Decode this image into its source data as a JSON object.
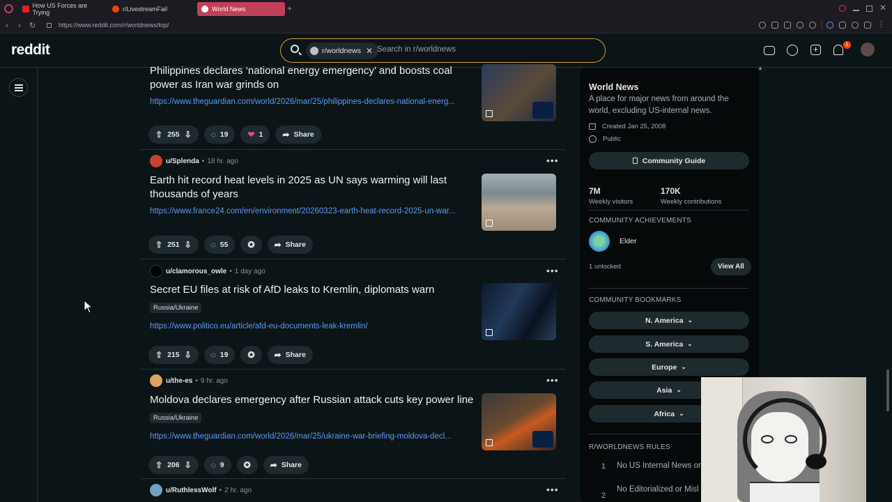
{
  "browser": {
    "tabs": [
      {
        "label": "How US Forces are Trying"
      },
      {
        "label": "r/LivestreamFail"
      },
      {
        "label": "World News"
      }
    ],
    "new_tab": "+",
    "url": "https://www.reddit.com/r/worldnews/top/"
  },
  "header": {
    "logo": "reddit",
    "search_chip": "r/worldnews",
    "search_placeholder": "Search in r/worldnews",
    "notification_count": "1"
  },
  "posts": [
    {
      "title": "Philippines declares ‘national energy emergency’ and boosts coal power as Iran war grinds on",
      "link": "https://www.theguardian.com/world/2026/mar/25/philippines-declares-national-energ...",
      "votes": "255",
      "comments": "19",
      "awards": "1",
      "share": "Share"
    },
    {
      "user": "u/Splenda",
      "time": "18 hr. ago",
      "title": "Earth hit record heat levels in 2025 as UN says warming will last thousands of years",
      "link": "https://www.france24.com/en/environment/20260323-earth-heat-record-2025-un-war...",
      "votes": "251",
      "comments": "55",
      "share": "Share"
    },
    {
      "user": "u/clamorous_owle",
      "time": "1 day ago",
      "title": "Secret EU files at risk of AfD leaks to Kremlin, diplomats warn",
      "flair": "Russia/Ukraine",
      "link": "https://www.politico.eu/article/afd-eu-documents-leak-kremlin/",
      "votes": "215",
      "comments": "19",
      "share": "Share"
    },
    {
      "user": "u/the-es",
      "time": "9 hr. ago",
      "title": "Moldova declares emergency after Russian attack cuts key power line",
      "flair": "Russia/Ukraine",
      "link": "https://www.theguardian.com/world/2026/mar/25/ukraine-war-briefing-moldova-decl...",
      "votes": "206",
      "comments": "9",
      "share": "Share"
    },
    {
      "user": "u/RuthlessWolf",
      "time": "2 hr. ago"
    }
  ],
  "sidebar": {
    "title": "World News",
    "description": "A place for major news from around the world, excluding US-internal news.",
    "created": "Created Jan 25, 2008",
    "visibility": "Public",
    "guide_button": "Community Guide",
    "visitors": "7M",
    "visitors_label": "Weekly visitors",
    "contributions": "170K",
    "contributions_label": "Weekly contributions",
    "achievements_heading": "COMMUNITY ACHIEVEMENTS",
    "achievement_name": "Elder",
    "unlocked": "1 unlocked",
    "view_all": "View All",
    "bookmarks_heading": "COMMUNITY BOOKMARKS",
    "bookmarks": [
      "N. America",
      "S. America",
      "Europe",
      "Asia",
      "Africa"
    ],
    "rules_heading": "R/WORLDNEWS RULES",
    "rules": [
      {
        "num": "1",
        "text": "No US Internal News or"
      },
      {
        "num": "2",
        "text": "No Editorialized or Misl"
      }
    ]
  },
  "colors": {
    "accent": "#ff4500",
    "link": "#5b9bf5",
    "active_tab": "#c0405a",
    "search_border": "#d4a42a"
  }
}
